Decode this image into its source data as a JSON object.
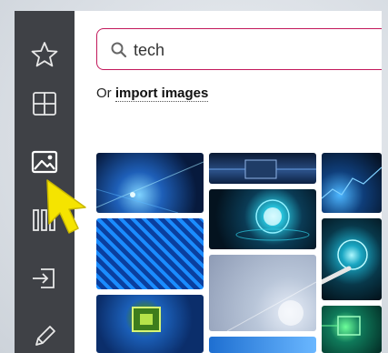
{
  "sidebar": {
    "items": [
      {
        "icon": "star-icon"
      },
      {
        "icon": "layout-grid-icon"
      },
      {
        "icon": "image-icon"
      },
      {
        "icon": "columns-icon"
      },
      {
        "icon": "import-icon"
      },
      {
        "icon": "pencil-icon"
      }
    ]
  },
  "search": {
    "value": "tech",
    "icon": "search-icon",
    "accent_color": "#c2185b"
  },
  "import": {
    "prefix": "Or",
    "link_label": "import images"
  },
  "results": {
    "thumbnails": [
      {
        "name": "tech-blue-network"
      },
      {
        "name": "tech-processor-chip"
      },
      {
        "name": "tech-blue-hud"
      },
      {
        "name": "tech-globe-glow"
      },
      {
        "name": "tech-circuit-board-blue"
      },
      {
        "name": "tech-hand-touch-ui"
      },
      {
        "name": "tech-grey-digital-lines"
      },
      {
        "name": "tech-green-chip"
      },
      {
        "name": "tech-blue-abstract"
      },
      {
        "name": "tech-green-circuit"
      }
    ]
  },
  "cursor": {
    "icon": "pointer-cursor-icon",
    "color": "#f5e400"
  }
}
